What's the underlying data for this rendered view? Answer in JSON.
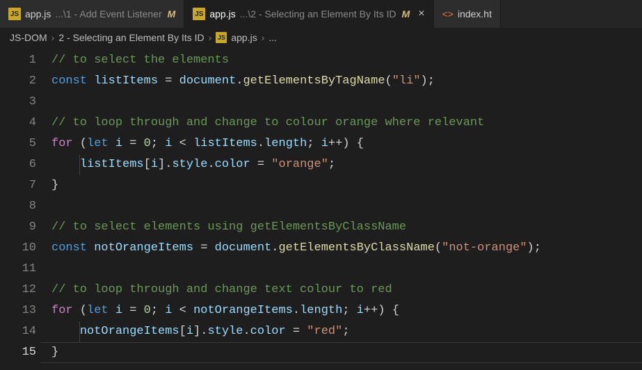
{
  "tabs": [
    {
      "file": "app.js",
      "path": "...\\1 - Add Event Listener",
      "modified": "M",
      "active": false,
      "icon": "js"
    },
    {
      "file": "app.js",
      "path": "...\\2 - Selecting an Element By Its ID",
      "modified": "M",
      "active": true,
      "icon": "js"
    },
    {
      "file": "index.ht",
      "path": "",
      "modified": "",
      "active": false,
      "icon": "html"
    }
  ],
  "breadcrumbs": {
    "parts": [
      "JS-DOM",
      "2 - Selecting an Element By Its ID"
    ],
    "file": "app.js",
    "trailing": "..."
  },
  "icons": {
    "js_label": "JS",
    "html_glyph": "<>",
    "close_glyph": "×",
    "sep_glyph": "›"
  },
  "code_lines": [
    {
      "n": 1,
      "tokens": [
        [
          "tk-comment",
          "// to select the elements"
        ]
      ]
    },
    {
      "n": 2,
      "tokens": [
        [
          "tk-decl",
          "const "
        ],
        [
          "tk-var",
          "listItems"
        ],
        [
          "tk-op",
          " = "
        ],
        [
          "tk-var",
          "document"
        ],
        [
          "tk-punc",
          "."
        ],
        [
          "tk-func",
          "getElementsByTagName"
        ],
        [
          "tk-punc",
          "("
        ],
        [
          "tk-str",
          "\"li\""
        ],
        [
          "tk-punc",
          ");"
        ]
      ]
    },
    {
      "n": 3,
      "tokens": []
    },
    {
      "n": 4,
      "tokens": [
        [
          "tk-comment",
          "// to loop through and change to colour orange where relevant"
        ]
      ]
    },
    {
      "n": 5,
      "tokens": [
        [
          "tk-keyword",
          "for"
        ],
        [
          "tk-punc",
          " ("
        ],
        [
          "tk-decl",
          "let "
        ],
        [
          "tk-var",
          "i"
        ],
        [
          "tk-op",
          " = "
        ],
        [
          "tk-num",
          "0"
        ],
        [
          "tk-punc",
          "; "
        ],
        [
          "tk-var",
          "i"
        ],
        [
          "tk-op",
          " < "
        ],
        [
          "tk-var",
          "listItems"
        ],
        [
          "tk-punc",
          "."
        ],
        [
          "tk-prop",
          "length"
        ],
        [
          "tk-punc",
          "; "
        ],
        [
          "tk-var",
          "i"
        ],
        [
          "tk-op",
          "++"
        ],
        [
          "tk-punc",
          ") {"
        ]
      ]
    },
    {
      "n": 6,
      "indent": 1,
      "tokens": [
        [
          "tk-var",
          "listItems"
        ],
        [
          "tk-punc",
          "["
        ],
        [
          "tk-var",
          "i"
        ],
        [
          "tk-punc",
          "]."
        ],
        [
          "tk-prop",
          "style"
        ],
        [
          "tk-punc",
          "."
        ],
        [
          "tk-prop",
          "color"
        ],
        [
          "tk-op",
          " = "
        ],
        [
          "tk-str",
          "\"orange\""
        ],
        [
          "tk-punc",
          ";"
        ]
      ]
    },
    {
      "n": 7,
      "tokens": [
        [
          "tk-punc",
          "}"
        ]
      ]
    },
    {
      "n": 8,
      "tokens": []
    },
    {
      "n": 9,
      "tokens": [
        [
          "tk-comment",
          "// to select elements using getElementsByClassName"
        ]
      ]
    },
    {
      "n": 10,
      "tokens": [
        [
          "tk-decl",
          "const "
        ],
        [
          "tk-var",
          "notOrangeItems"
        ],
        [
          "tk-op",
          " = "
        ],
        [
          "tk-var",
          "document"
        ],
        [
          "tk-punc",
          "."
        ],
        [
          "tk-func",
          "getElementsByClassName"
        ],
        [
          "tk-punc",
          "("
        ],
        [
          "tk-str",
          "\"not-orange\""
        ],
        [
          "tk-punc",
          ");"
        ]
      ]
    },
    {
      "n": 11,
      "tokens": []
    },
    {
      "n": 12,
      "tokens": [
        [
          "tk-comment",
          "// to loop through and change text colour to red"
        ]
      ]
    },
    {
      "n": 13,
      "tokens": [
        [
          "tk-keyword",
          "for"
        ],
        [
          "tk-punc",
          " ("
        ],
        [
          "tk-decl",
          "let "
        ],
        [
          "tk-var",
          "i"
        ],
        [
          "tk-op",
          " = "
        ],
        [
          "tk-num",
          "0"
        ],
        [
          "tk-punc",
          "; "
        ],
        [
          "tk-var",
          "i"
        ],
        [
          "tk-op",
          " < "
        ],
        [
          "tk-var",
          "notOrangeItems"
        ],
        [
          "tk-punc",
          "."
        ],
        [
          "tk-prop",
          "length"
        ],
        [
          "tk-punc",
          "; "
        ],
        [
          "tk-var",
          "i"
        ],
        [
          "tk-op",
          "++"
        ],
        [
          "tk-punc",
          ") {"
        ]
      ]
    },
    {
      "n": 14,
      "indent": 1,
      "tokens": [
        [
          "tk-var",
          "notOrangeItems"
        ],
        [
          "tk-punc",
          "["
        ],
        [
          "tk-var",
          "i"
        ],
        [
          "tk-punc",
          "]."
        ],
        [
          "tk-prop",
          "style"
        ],
        [
          "tk-punc",
          "."
        ],
        [
          "tk-prop",
          "color"
        ],
        [
          "tk-op",
          " = "
        ],
        [
          "tk-str",
          "\"red\""
        ],
        [
          "tk-punc",
          ";"
        ]
      ]
    },
    {
      "n": 15,
      "current": true,
      "tokens": [
        [
          "tk-punc",
          "}"
        ]
      ]
    }
  ]
}
